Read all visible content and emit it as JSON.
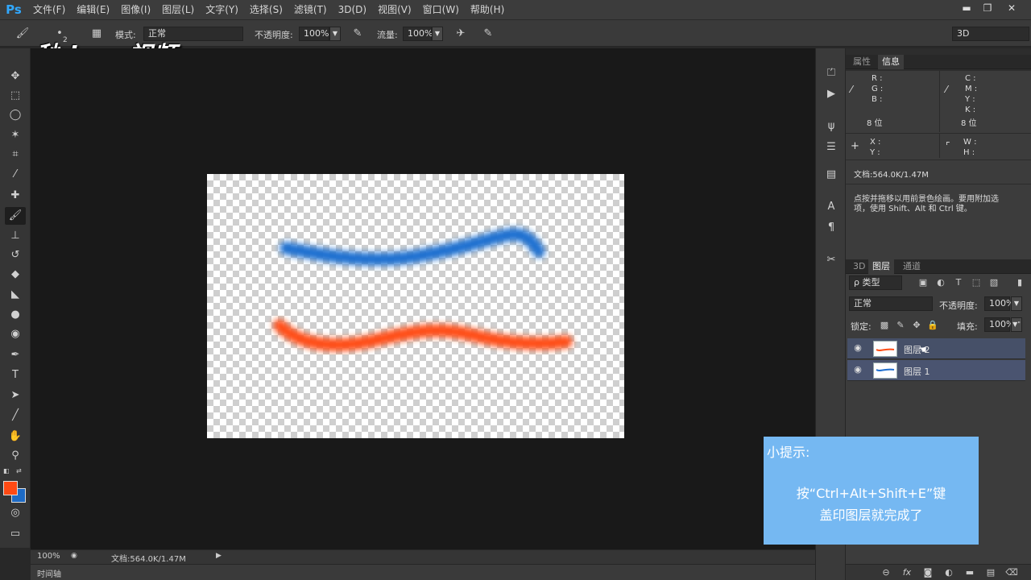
{
  "app": {
    "logo": "Ps"
  },
  "menu": [
    "文件(F)",
    "编辑(E)",
    "图像(I)",
    "图层(L)",
    "文字(Y)",
    "选择(S)",
    "滤镜(T)",
    "3D(D)",
    "视图(V)",
    "窗口(W)",
    "帮助(H)"
  ],
  "window_controls": [
    "▬",
    "❐",
    "✕"
  ],
  "options": {
    "brush_size": "2",
    "mode_label": "模式:",
    "mode_value": "正常",
    "opacity_label": "不透明度:",
    "opacity_value": "100%",
    "flow_label": "流量:",
    "flow_value": "100%",
    "workspace": "3D"
  },
  "watermark": "秒dong视频",
  "status": {
    "zoom": "100%",
    "doc": "文档:564.0K/1.47M"
  },
  "timeline_label": "时间轴",
  "info_panel": {
    "tabs": [
      "属性",
      "信息"
    ],
    "r": "R :",
    "g": "G :",
    "b": "B :",
    "c": "C :",
    "m": "M :",
    "y": "Y :",
    "k": "K :",
    "bits_left": "8 位",
    "bits_right": "8 位",
    "x": "X :",
    "yy": "Y :",
    "w": "W :",
    "h": "H :",
    "doc": "文档:564.0K/1.47M",
    "hint_line1": "点按并拖移以用前景色绘画。要用附加选",
    "hint_line2": "项，使用 Shift、Alt 和 Ctrl 键。"
  },
  "layers_panel": {
    "tabs": [
      "3D",
      "图层",
      "通道"
    ],
    "filter": "ρ 类型",
    "blend": "正常",
    "opacity_label": "不透明度:",
    "opacity_value": "100%",
    "lock_label": "锁定:",
    "fill_label": "填充:",
    "fill_value": "100%",
    "layers": [
      {
        "name": "图层 2"
      },
      {
        "name": "图层 1"
      }
    ]
  },
  "tip": {
    "title": "小提示:",
    "line1": "按“Ctrl+Alt+Shift+E”键",
    "line2": "盖印图层就完成了"
  },
  "colors": {
    "foreground": "#ff4a14",
    "background": "#1d6ac4",
    "stroke_blue": "#1f6fd0",
    "stroke_orange": "#ff4d14",
    "tip_bg": "#75b8f2"
  }
}
